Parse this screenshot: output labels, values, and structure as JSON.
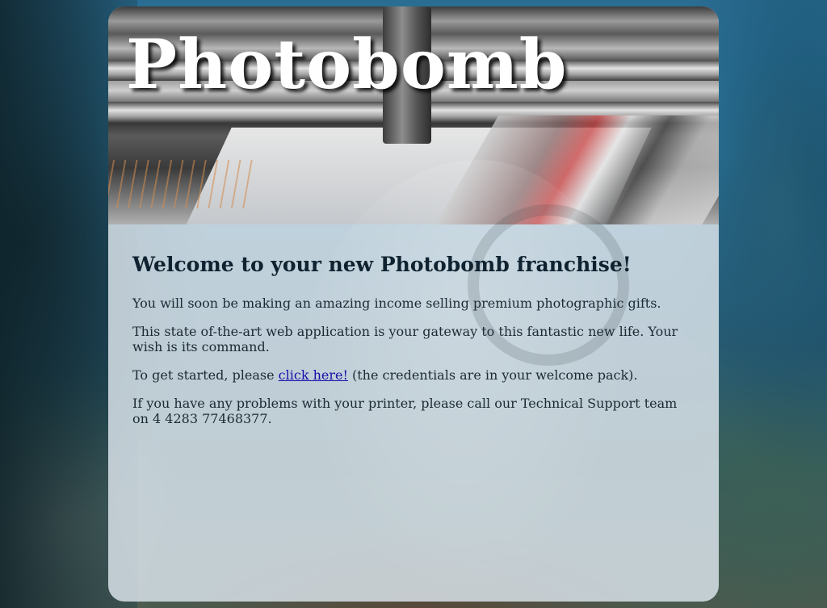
{
  "header": {
    "site_title": "Photobomb"
  },
  "main": {
    "heading": "Welcome to your new Photobomb franchise!",
    "para1": "You will soon be making an amazing income selling premium photographic gifts.",
    "para2": "This state of-the-art web application is your gateway to this fantastic new life. Your wish is its command.",
    "para3_prefix": "To get started, please ",
    "para3_link": "click here!",
    "para3_suffix": " (the credentials are in your welcome pack).",
    "para4": "If you have any problems with your printer, please call our Technical Support team on 4 4283 77468377."
  },
  "colors": {
    "link": "#1a0dab",
    "title_text": "#ffffff",
    "body_text": "#1c2a33",
    "card_background": "rgba(215,225,232,0.86)"
  }
}
